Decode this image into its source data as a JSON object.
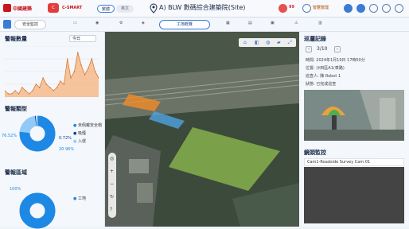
{
  "header": {
    "brand_a": "中國建築",
    "brand_b_icon": "C",
    "brand_b": "C-SMART",
    "tab_a": "繁體",
    "tab_b": "英文",
    "project_title": "A) BLW 數碼綜合建築院(Site)",
    "alert_count": "99",
    "user_label": "智慧管理",
    "colors": {
      "accent": "#3a7bd5",
      "danger": "#e85050"
    }
  },
  "nav": {
    "left_button": "安全監控",
    "active_tab": "工地概覽",
    "icons": [
      "monitor-icon",
      "camera-icon",
      "robot-icon",
      "map-icon",
      "calendar-icon",
      "chart-icon",
      "truck-icon",
      "warning-icon",
      "document-icon"
    ]
  },
  "left": {
    "section1_title": "警報數量",
    "section1_select": "今日",
    "section2_title": "警報類型",
    "section2_pct_a": "76.52%",
    "section2_pct_b": "0.72%",
    "section2_pct_c": "20.96%",
    "section2_legend_a": "未佩戴安全帽",
    "section2_legend_b": "吸煙",
    "section2_legend_c": "入侵",
    "section3_title": "警報區域",
    "section3_pct": "100%",
    "section3_legend": "工地"
  },
  "chart_data": {
    "type": "area",
    "title": "警報數量",
    "series": [
      {
        "values": [
          2,
          1,
          1,
          2,
          1,
          3,
          2,
          1,
          2,
          4,
          3,
          6,
          4,
          3,
          2,
          3,
          5,
          4,
          12,
          6,
          8,
          14,
          10,
          7,
          9,
          12,
          8,
          6
        ]
      }
    ]
  },
  "map": {
    "toolbar_icons": [
      "home-icon",
      "layer-icon",
      "pin-icon",
      "measure-icon",
      "fullscreen-icon"
    ],
    "side_tools": [
      "compass-icon",
      "zoom-in-icon",
      "zoom-out-icon",
      "rotate-icon",
      "help-icon"
    ]
  },
  "right": {
    "record_title": "巡邏記錄",
    "record_nav": "3/10",
    "time_line": "時間: 2024年1月19日 17時50分",
    "location_line": "位置: 沙田區A1(車路)",
    "person_line": "巡查人: 陳 Robot 1",
    "status_line": "狀態: 已完成巡查",
    "cctv_title": "鏡頭監控",
    "cctv_name": "Cam1-Roadside Survey Cam 01"
  }
}
